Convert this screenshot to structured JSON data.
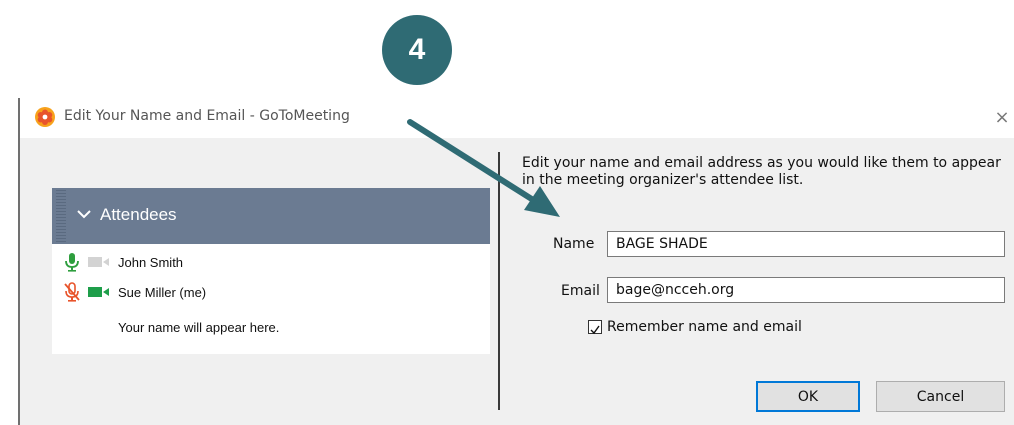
{
  "step": {
    "number": "4",
    "color": "#2f6b74"
  },
  "window": {
    "title": "Edit Your Name and Email - GoToMeeting",
    "close_glyph": "×",
    "icon": "gotomeeting-flower-icon"
  },
  "attendees_panel": {
    "header": "Attendees",
    "header_color": "#6b7b92",
    "rows": [
      {
        "name": "John Smith",
        "mic": "mic-on-icon",
        "camera": "camera-off-icon"
      },
      {
        "name": "Sue Miller (me)",
        "mic": "mic-muted-icon",
        "camera": "camera-on-icon"
      }
    ],
    "note": "Your name will appear here."
  },
  "form": {
    "instructions": "Edit your name and email address as you would like them to appear in the meeting organizer's attendee list.",
    "name_label": "Name",
    "name_value": "BAGE SHADE",
    "email_label": "Email",
    "email_value": "bage@ncceh.org",
    "remember_label": "Remember name and email",
    "remember_checked": true,
    "ok_label": "OK",
    "cancel_label": "Cancel"
  },
  "colors": {
    "mic_on": "#2e9e3e",
    "mic_muted": "#e8542b",
    "cam_on": "#1e9e4a",
    "arrow": "#2f6b74"
  }
}
